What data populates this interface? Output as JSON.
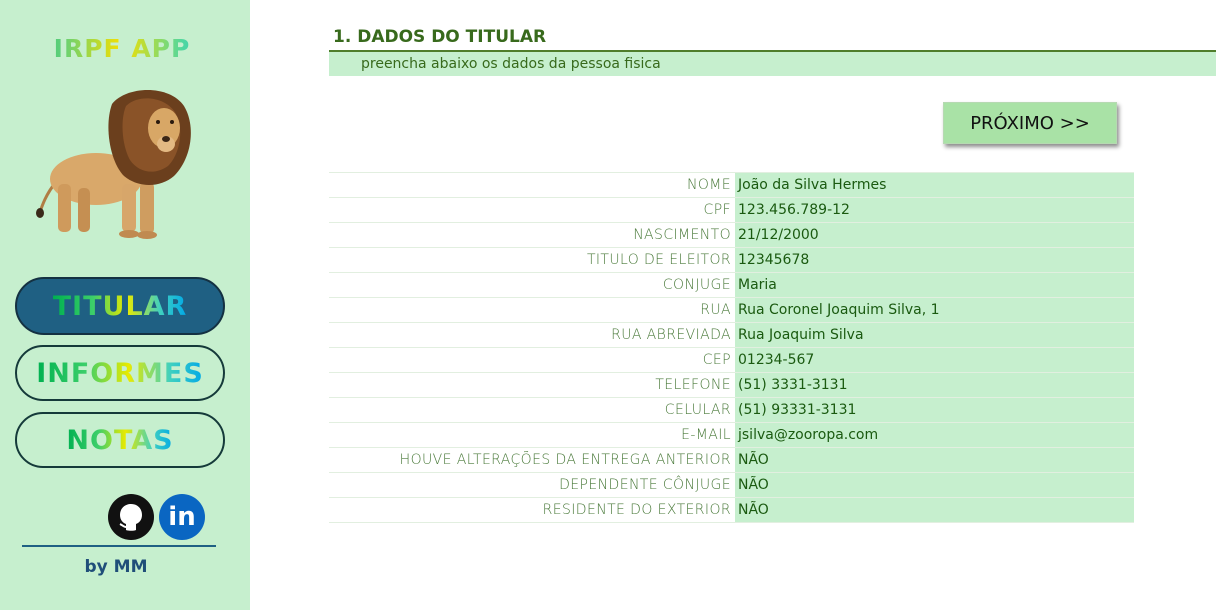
{
  "sidebar": {
    "app_title": "IRPF APP",
    "nav": {
      "titular": "TITULAR",
      "informes": "INFORMES",
      "notas": "NOTAS"
    },
    "social": {
      "github_icon": "github-icon",
      "linkedin_label": "in"
    },
    "byline": "by MM"
  },
  "main": {
    "section_title": "1. DADOS DO TITULAR",
    "section_subtitle": "preencha abaixo os dados da pessoa fisica",
    "next_label": "PRÓXIMO >>"
  },
  "form": {
    "fields": [
      {
        "label": "NOME",
        "value": "João da Silva Hermes"
      },
      {
        "label": "CPF",
        "value": "123.456.789-12"
      },
      {
        "label": "NASCIMENTO",
        "value": "21/12/2000"
      },
      {
        "label": "TITULO DE ELEITOR",
        "value": "12345678"
      },
      {
        "label": "CONJUGE",
        "value": "Maria"
      },
      {
        "label": "RUA",
        "value": "Rua Coronel Joaquim Silva, 1"
      },
      {
        "label": "RUA ABREVIADA",
        "value": "Rua Joaquim Silva"
      },
      {
        "label": "CEP",
        "value": "01234-567"
      },
      {
        "label": "TELEFONE",
        "value": "(51) 3331-3131"
      },
      {
        "label": "CELULAR",
        "value": "(51) 93331-3131"
      },
      {
        "label": "E-MAIL",
        "value": "jsilva@zooropa.com"
      },
      {
        "label": "HOUVE ALTERAÇÕES DA ENTREGA ANTERIOR",
        "value": "NÃO"
      },
      {
        "label": "DEPENDENTE CÔNJUGE",
        "value": "NÃO"
      },
      {
        "label": "RESIDENTE DO EXTERIOR",
        "value": "NÃO"
      }
    ]
  },
  "colors": {
    "sidebar_bg": "#c6efce",
    "active_nav": "#1f6083",
    "title_green": "#386a1c",
    "field_bg": "#c6efce",
    "button_bg": "#a9e2a6"
  }
}
